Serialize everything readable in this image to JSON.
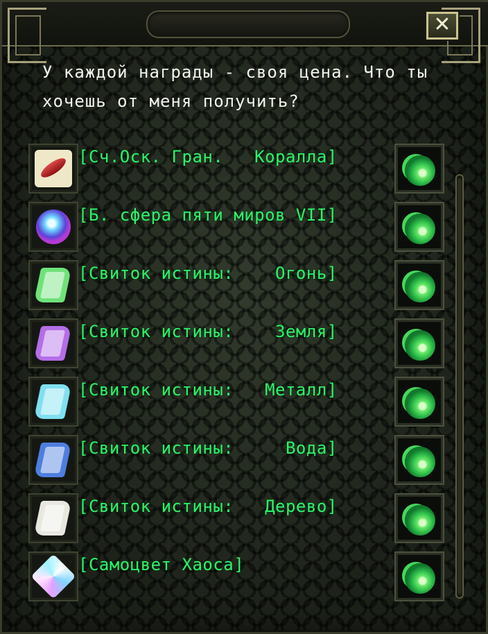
{
  "dialog": {
    "close_label": "✕",
    "prompt": "У каждой награды - своя цена. Что ты\nхочешь от меня получить?"
  },
  "items": [
    {
      "name": "[Сч.Оск. Гран.   Коралла]",
      "icon": "coral-shard-icon",
      "color": "#c8262a"
    },
    {
      "name": "[Б. сфера пяти миров VII]",
      "icon": "five-worlds-sphere-icon",
      "color": "#6fd3ff"
    },
    {
      "name": "[Свиток истины:    Огонь]",
      "icon": "scroll-icon",
      "color": "#6fe27a"
    },
    {
      "name": "[Свиток истины:    Земля]",
      "icon": "scroll-icon",
      "color": "#b46ee8"
    },
    {
      "name": "[Свиток истины:   Металл]",
      "icon": "scroll-icon",
      "color": "#7fe0f0"
    },
    {
      "name": "[Свиток истины:     Вода]",
      "icon": "scroll-icon",
      "color": "#4f7ee0"
    },
    {
      "name": "[Свиток истины:   Дерево]",
      "icon": "scroll-icon",
      "color": "#e8e8e0"
    },
    {
      "name": "[Самоцвет Хаоса]",
      "icon": "chaos-gem-icon",
      "color": "#c8a8ff"
    }
  ],
  "colors": {
    "item_text": "#2ef26a",
    "prompt_text": "#f3f3ee",
    "reward_button": "#2fbf4b"
  }
}
